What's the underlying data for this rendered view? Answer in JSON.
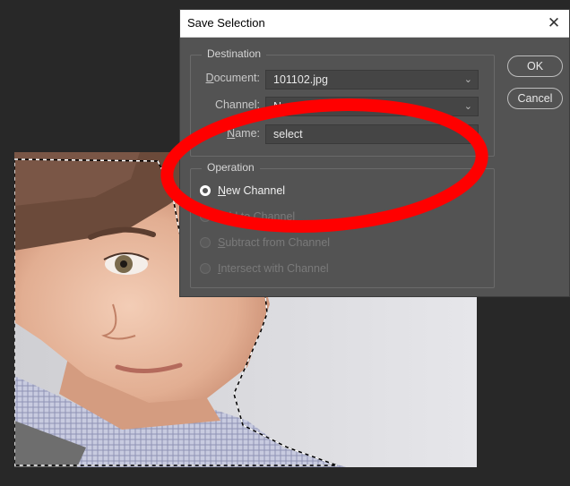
{
  "dialog": {
    "title": "Save Selection",
    "ok_label": "OK",
    "cancel_label": "Cancel",
    "destination": {
      "legend": "Destination",
      "document_label_prefix": "D",
      "document_label_rest": "ocument:",
      "document_value": "101102.jpg",
      "channel_value": "New",
      "name_label_prefix": "N",
      "name_label_rest": "ame:",
      "name_value": "select"
    },
    "operation": {
      "legend": "Operation",
      "options": [
        {
          "prefix": "N",
          "rest": "ew Channel",
          "selected": true,
          "enabled": true
        },
        {
          "prefix": "A",
          "rest": "dd to Channel",
          "selected": false,
          "enabled": false
        },
        {
          "prefix": "S",
          "rest": "ubtract from Channel",
          "selected": false,
          "enabled": false
        },
        {
          "prefix": "I",
          "rest": "ntersect with Channel",
          "selected": false,
          "enabled": false
        }
      ]
    }
  },
  "icons": {
    "close": "close-icon",
    "dropdown": "chevron-down-icon"
  },
  "annotation": {
    "color": "#ff0000"
  }
}
